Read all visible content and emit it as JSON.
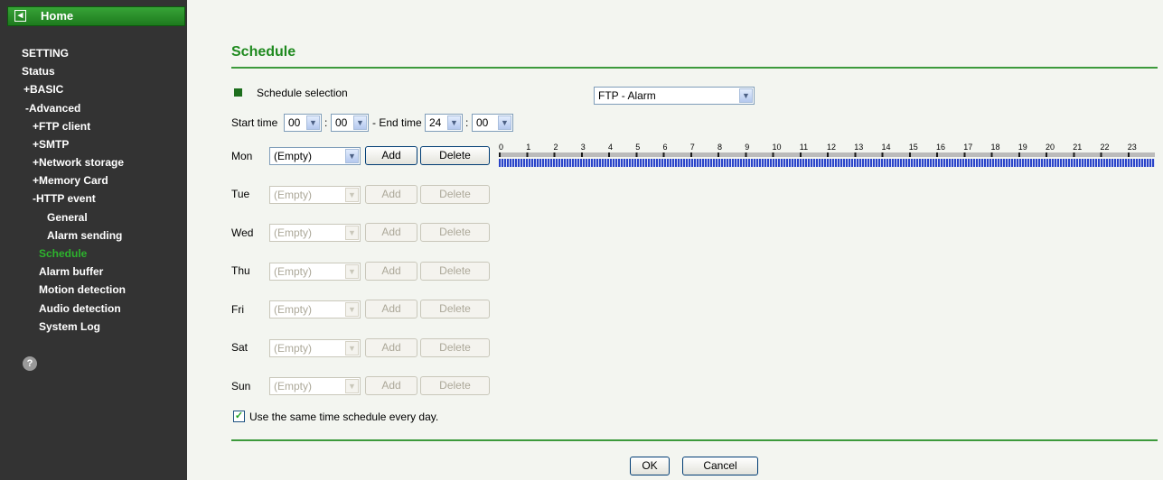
{
  "sidebar": {
    "home": "Home",
    "setting": "SETTING",
    "items": [
      "Status",
      "+BASIC",
      "-Advanced",
      "+FTP client",
      "+SMTP",
      "+Network storage",
      "+Memory Card",
      "-HTTP event",
      "General",
      "Alarm sending",
      "Schedule",
      "Alarm buffer",
      "Motion detection",
      "Audio detection",
      "System Log"
    ],
    "current": "Schedule",
    "help_glyph": "?"
  },
  "main": {
    "title": "Schedule",
    "schedule_selection_label": "Schedule selection",
    "schedule_selection_value": "FTP - Alarm",
    "start_time_label": "Start time",
    "start_hour": "00",
    "start_min": "00",
    "end_time_label": "- End time",
    "end_hour": "24",
    "end_min": "00",
    "days": [
      {
        "label": "Mon",
        "value": "(Empty)",
        "add": "Add",
        "delete": "Delete",
        "enabled": true
      },
      {
        "label": "Tue",
        "value": "(Empty)",
        "add": "Add",
        "delete": "Delete",
        "enabled": false
      },
      {
        "label": "Wed",
        "value": "(Empty)",
        "add": "Add",
        "delete": "Delete",
        "enabled": false
      },
      {
        "label": "Thu",
        "value": "(Empty)",
        "add": "Add",
        "delete": "Delete",
        "enabled": false
      },
      {
        "label": "Fri",
        "value": "(Empty)",
        "add": "Add",
        "delete": "Delete",
        "enabled": false
      },
      {
        "label": "Sat",
        "value": "(Empty)",
        "add": "Add",
        "delete": "Delete",
        "enabled": false
      },
      {
        "label": "Sun",
        "value": "(Empty)",
        "add": "Add",
        "delete": "Delete",
        "enabled": false
      }
    ],
    "hours": [
      "0",
      "1",
      "2",
      "3",
      "4",
      "5",
      "6",
      "7",
      "8",
      "9",
      "10",
      "11",
      "12",
      "13",
      "14",
      "15",
      "16",
      "17",
      "18",
      "19",
      "20",
      "21",
      "22",
      "23"
    ],
    "same_schedule_label": "Use the same time schedule every day.",
    "same_schedule_checked": true,
    "ok": "OK",
    "cancel": "Cancel"
  },
  "colors": {
    "accent": "#1f8a1f",
    "sidebar_bg": "#333333",
    "current_item": "#2db32d",
    "timeline": "#2a44c8"
  }
}
